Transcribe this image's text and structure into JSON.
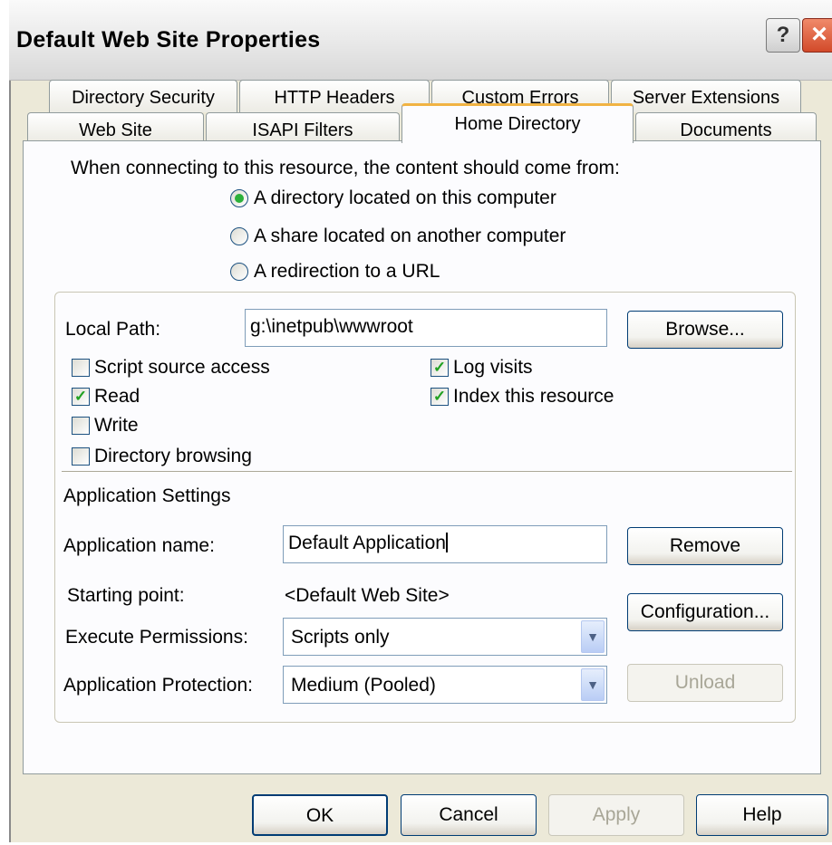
{
  "window": {
    "title": "Default Web Site Properties"
  },
  "tabs_row1": [
    "Directory Security",
    "HTTP Headers",
    "Custom Errors",
    "Server Extensions"
  ],
  "tabs_row2": [
    "Web Site",
    "ISAPI Filters",
    "Home Directory",
    "Documents"
  ],
  "active_tab": "Home Directory",
  "content_source": {
    "prompt": "When connecting to this resource, the content should come from:",
    "options": [
      "A directory located on this computer",
      "A share located on another computer",
      "A redirection to a URL"
    ],
    "selected": "A directory located on this computer"
  },
  "local_path": {
    "label": "Local Path:",
    "value": "g:\\inetpub\\wwwroot",
    "browse_label": "Browse..."
  },
  "permissions": {
    "script_source_access": {
      "label": "Script source access",
      "checked": false
    },
    "read": {
      "label": "Read",
      "checked": true
    },
    "write": {
      "label": "Write",
      "checked": false
    },
    "directory_browsing": {
      "label": "Directory browsing",
      "checked": false
    },
    "log_visits": {
      "label": "Log visits",
      "checked": true
    },
    "index_this_resource": {
      "label": "Index this resource",
      "checked": true
    }
  },
  "app_settings": {
    "heading": "Application Settings",
    "app_name_label": "Application name:",
    "app_name_value": "Default Application",
    "starting_point_label": "Starting point:",
    "starting_point_value": "<Default Web Site>",
    "exec_perm_label": "Execute Permissions:",
    "exec_perm_value": "Scripts only",
    "app_protection_label": "Application Protection:",
    "app_protection_value": "Medium (Pooled)",
    "remove_label": "Remove",
    "configuration_label": "Configuration...",
    "unload_label": "Unload"
  },
  "footer": {
    "ok": "OK",
    "cancel": "Cancel",
    "apply": "Apply",
    "help": "Help"
  },
  "icons": {
    "help": "?",
    "close": "×",
    "check": "✓",
    "dropdown": "▼"
  }
}
